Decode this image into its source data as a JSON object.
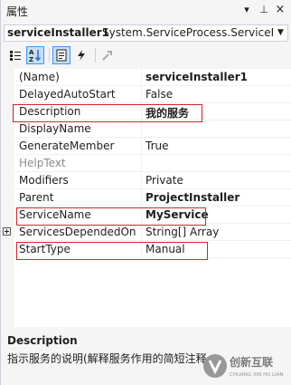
{
  "window": {
    "title": "属性"
  },
  "title_buttons": {
    "dropdown": "▾",
    "pin": "⊥",
    "close": "×"
  },
  "object_selector": {
    "name": "serviceInstaller1",
    "type": "System.ServiceProcess.ServiceInst"
  },
  "toolbar": {
    "tools": [
      "categorized-icon",
      "alphabetical-icon",
      "properties-icon",
      "events-icon",
      "property-pages-icon"
    ]
  },
  "grid": {
    "rows": [
      {
        "name": "(Name)",
        "value": "serviceInstaller1",
        "bold": true
      },
      {
        "name": "DelayedAutoStart",
        "value": "False"
      },
      {
        "name": "Description",
        "value": "我的服务",
        "bold": true
      },
      {
        "name": "DisplayName",
        "value": ""
      },
      {
        "name": "GenerateMember",
        "value": "True"
      },
      {
        "name": "HelpText",
        "value": "",
        "disabled": true
      },
      {
        "name": "Modifiers",
        "value": "Private"
      },
      {
        "name": "Parent",
        "value": "ProjectInstaller",
        "bold": true
      },
      {
        "name": "ServiceName",
        "value": "MyService",
        "bold": true
      },
      {
        "name": "ServicesDependedOn",
        "value": "String[] Array",
        "expandable": true
      },
      {
        "name": "StartType",
        "value": "Manual"
      }
    ],
    "highlight_color": "#d9212a"
  },
  "description": {
    "title": "Description",
    "text": "指示服务的说明(解释服务作用的简短注释"
  },
  "watermark": {
    "line1": "创新互联",
    "line2": "CHUANG XIN HU LIAN"
  }
}
